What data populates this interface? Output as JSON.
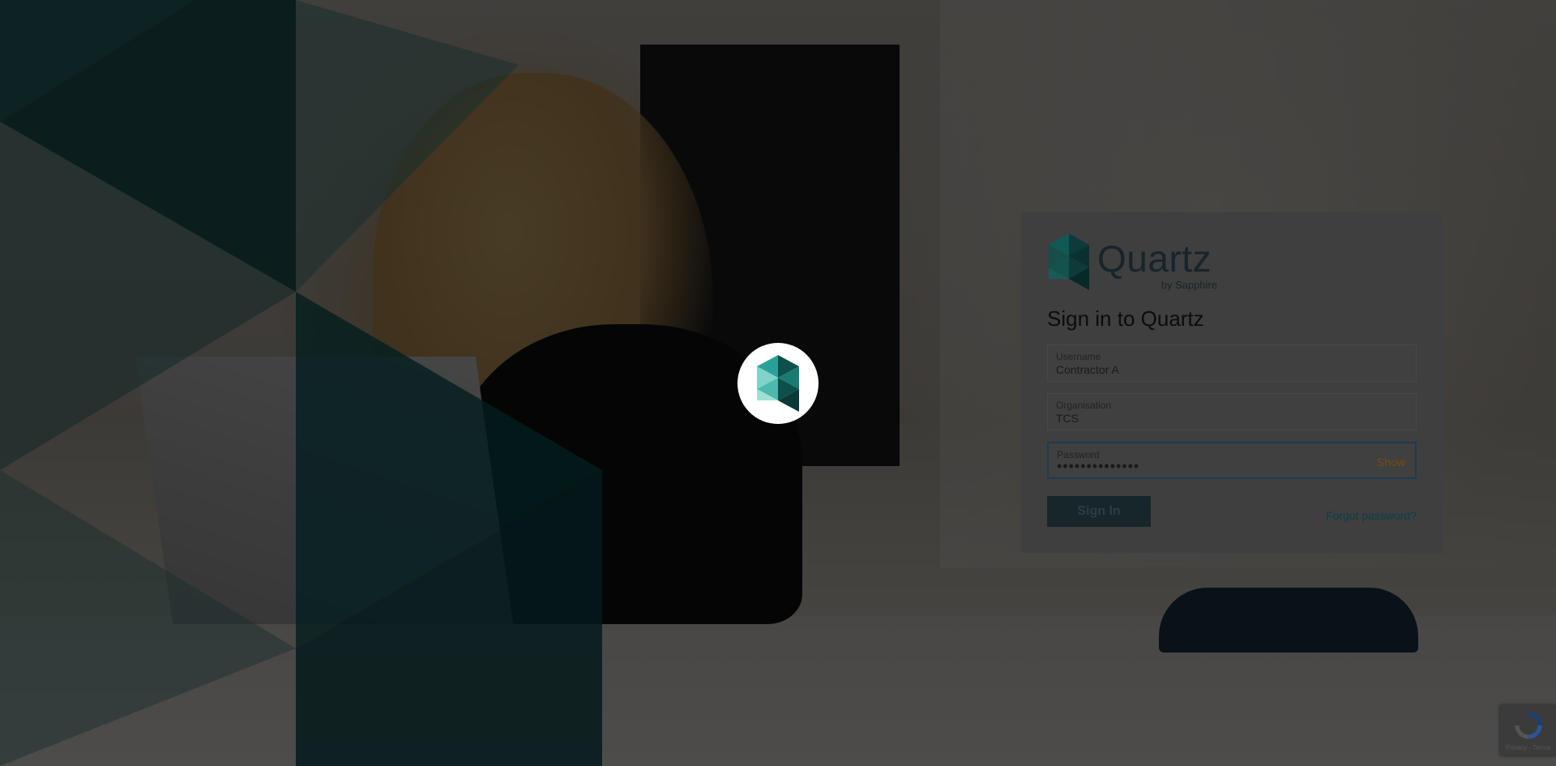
{
  "brand": {
    "name": "Quartz",
    "sub": "by Sapphire"
  },
  "login": {
    "title": "Sign in to Quartz",
    "username": {
      "label": "Username",
      "value": "Contractor A"
    },
    "organisation": {
      "label": "Organisation",
      "value": "TCS"
    },
    "password": {
      "label": "Password",
      "value": "••••••••••••••",
      "show_label": "Show"
    },
    "signin_label": "Sign In",
    "forgot_label": "Forgot password?"
  },
  "recaptcha": {
    "text": "Privacy - Terms"
  },
  "colors": {
    "teal_dark": "#0d4f4b",
    "teal_mid": "#2aa198",
    "teal_light": "#7fd3c8",
    "navy": "#17262a",
    "accent_orange": "#7a4a12"
  },
  "icons": {
    "logo": "quartz-crystal-icon",
    "spinner": "quartz-crystal-icon",
    "recaptcha": "recaptcha-icon"
  }
}
